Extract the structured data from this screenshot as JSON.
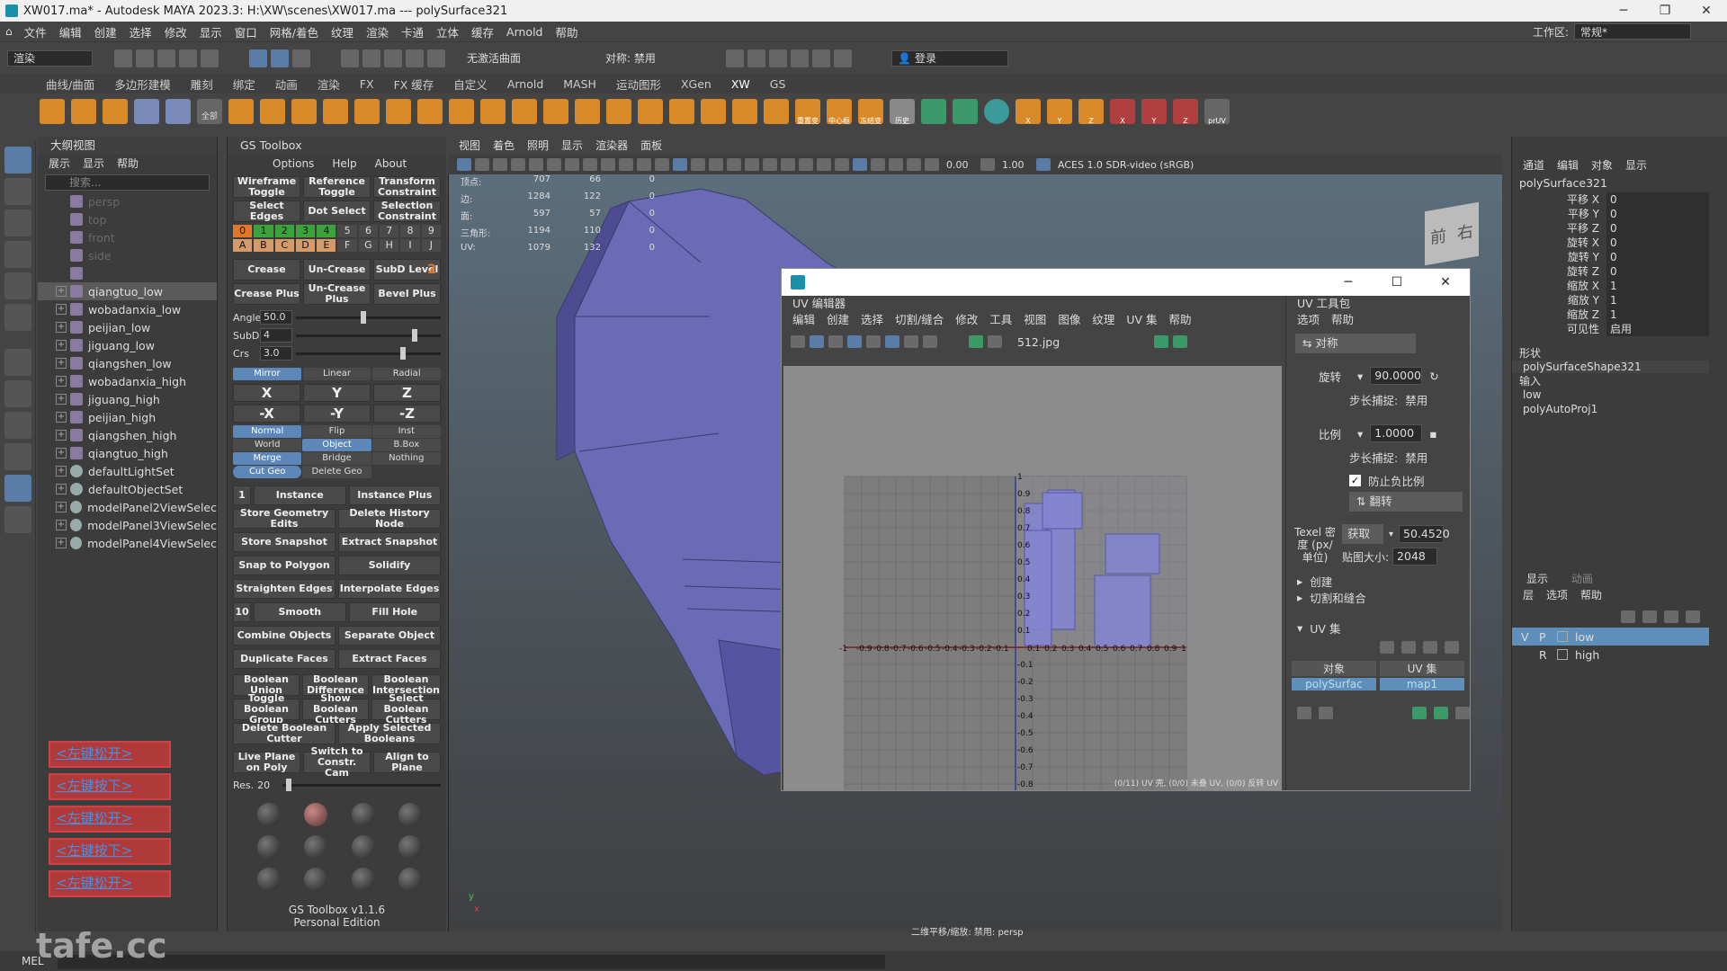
{
  "titlebar": {
    "title": "XW017.ma* - Autodesk MAYA 2023.3: H:\\XW\\scenes\\XW017.ma  ---  polySurface321"
  },
  "menubar": {
    "items": [
      "文件",
      "编辑",
      "创建",
      "选择",
      "修改",
      "显示",
      "窗口",
      "网格/着色",
      "纹理",
      "渲染",
      "卡通",
      "立体",
      "缓存",
      "Arnold",
      "帮助"
    ],
    "workspace_label": "工作区:",
    "workspace_value": "常规*"
  },
  "statusline": {
    "mode": "渲染",
    "live_surface": "无激活曲面",
    "symmetry": "对称: 禁用",
    "login": "登录"
  },
  "shelf": {
    "tabs": [
      "曲线/曲面",
      "多边形建模",
      "雕刻",
      "绑定",
      "动画",
      "渲染",
      "FX",
      "FX 缓存",
      "自定义",
      "Arnold",
      "MASH",
      "运动图形",
      "XGen",
      "XW",
      "GS"
    ],
    "active_tab": "XW",
    "labels": [
      "全部",
      "重置变",
      "中心枢",
      "冻结变",
      "历史",
      "X",
      "Y",
      "Z",
      "X",
      "Y",
      "Z",
      "prUV"
    ]
  },
  "outliner": {
    "title": "大纲视图",
    "menu": [
      "展示",
      "显示",
      "帮助"
    ],
    "search_placeholder": "搜索...",
    "items": [
      {
        "label": "persp",
        "dim": true
      },
      {
        "label": "top",
        "dim": true
      },
      {
        "label": "front",
        "dim": true
      },
      {
        "label": "side",
        "dim": true
      },
      {
        "label": "",
        "dim": true
      },
      {
        "label": "qiangtuo_low",
        "sel": true
      },
      {
        "label": "wobadanxia_low"
      },
      {
        "label": "peijian_low"
      },
      {
        "label": "jiguang_low"
      },
      {
        "label": "qiangshen_low"
      },
      {
        "label": "wobadanxia_high"
      },
      {
        "label": "jiguang_high"
      },
      {
        "label": "peijian_high"
      },
      {
        "label": "qiangshen_high"
      },
      {
        "label": "qiangtuo_high"
      },
      {
        "label": "defaultLightSet"
      },
      {
        "label": "defaultObjectSet"
      },
      {
        "label": "modelPanel2ViewSelec"
      },
      {
        "label": "modelPanel3ViewSelec"
      },
      {
        "label": "modelPanel4ViewSelec"
      }
    ],
    "red_buttons": [
      "<左键松开>",
      "<左键按下>",
      "<左键松开>",
      "<左键按下>",
      "<左键松开>"
    ]
  },
  "gstoolbox": {
    "title": "GS Toolbox",
    "menu": [
      "Options",
      "Help",
      "About"
    ],
    "row1": [
      "Wireframe Toggle",
      "Reference Toggle",
      "Transform Constraint"
    ],
    "row2": [
      "Select Edges",
      "Dot Select",
      "Selection Constraint"
    ],
    "nums": [
      "0",
      "1",
      "2",
      "3",
      "4",
      "5",
      "6",
      "7",
      "8",
      "9"
    ],
    "letters": [
      "A",
      "B",
      "C",
      "D",
      "E",
      "F",
      "G",
      "H",
      "I",
      "J"
    ],
    "row3": [
      "Crease",
      "Un-Crease",
      "SubD Level",
      "2"
    ],
    "row4": [
      "Crease Plus",
      "Un-Crease Plus",
      "Bevel Plus"
    ],
    "angle_label": "Angle",
    "angle_val": "50.0",
    "subd_label": "SubD",
    "subd_val": "4",
    "crs_label": "Crs",
    "crs_val": "3.0",
    "sym_modes": [
      "Mirror",
      "Linear",
      "Radial"
    ],
    "axes": [
      "X",
      "Y",
      "Z",
      "-X",
      "-Y",
      "-Z"
    ],
    "opts1": [
      "Normal",
      "Flip",
      "Inst"
    ],
    "opts2": [
      "World",
      "Object",
      "B.Box"
    ],
    "opts3": [
      "Merge",
      "Bridge",
      "Nothing"
    ],
    "opts4": [
      "Cut Geo",
      "Delete Geo"
    ],
    "instance_count": "1",
    "buttons": [
      [
        "Instance",
        "Instance Plus"
      ],
      [
        "Store Geometry Edits",
        "Delete History Node"
      ],
      [
        "Store Snapshot",
        "Extract Snapshot"
      ],
      [
        "Snap to Polygon",
        "Solidify"
      ],
      [
        "Straighten Edges",
        "Interpolate Edges"
      ],
      [
        "Smooth",
        "Fill Hole"
      ],
      [
        "Combine Objects",
        "Separate Object"
      ],
      [
        "Duplicate Faces",
        "Extract Faces"
      ]
    ],
    "smooth_count": "10",
    "bool_row1": [
      "Boolean Union",
      "Boolean Difference",
      "Boolean Intersection"
    ],
    "bool_row2": [
      "Toggle Boolean Group",
      "Show Boolean Cutters",
      "Select Boolean Cutters"
    ],
    "bool_row3": [
      "Delete Boolean Cutter",
      "Apply Selected Booleans"
    ],
    "plane_row": [
      "Live Plane on Poly",
      "Switch to Constr. Cam",
      "Align to Plane"
    ],
    "res_label": "Res.",
    "res_val": "20",
    "footer1": "GS Toolbox v1.1.6",
    "footer2": "Personal Edition"
  },
  "viewport": {
    "menu": [
      "视图",
      "着色",
      "照明",
      "显示",
      "渲染器",
      "面板"
    ],
    "exposure": "0.00",
    "gamma": "1.00",
    "colorspace": "ACES 1.0 SDR-video (sRGB)",
    "hud_rows": [
      {
        "label": "顶点:",
        "a": "707",
        "b": "66",
        "c": "0"
      },
      {
        "label": "边:",
        "a": "1284",
        "b": "122",
        "c": "0"
      },
      {
        "label": "面:",
        "a": "597",
        "b": "57",
        "c": "0"
      },
      {
        "label": "三角形:",
        "a": "1194",
        "b": "110",
        "c": "0"
      },
      {
        "label": "UV:",
        "a": "1079",
        "b": "132",
        "c": "0"
      }
    ],
    "viewcube_front": "前",
    "viewcube_right": "右",
    "camera_label": "二维平移/缩放: 禁用: persp"
  },
  "uv_editor": {
    "panel_title": "UV 编辑器",
    "menu": [
      "编辑",
      "创建",
      "选择",
      "切割/缝合",
      "修改",
      "工具",
      "视图",
      "图像",
      "纹理",
      "UV 集",
      "帮助"
    ],
    "texture": "512.jpg",
    "status": "(0/11) UV 壳, (0/0) 未叠 UV, (0/0) 反转 UV",
    "axis_x": [
      "-1",
      "-0.9",
      "-0.8",
      "-0.7",
      "-0.6",
      "-0.5",
      "-0.4",
      "-0.3",
      "-0.2",
      "-0.1",
      "0.1",
      "0.2",
      "0.3",
      "0.4",
      "0.5",
      "0.6",
      "0.7",
      "0.8",
      "0.9",
      "1"
    ],
    "axis_y_pos": [
      "1",
      "0.9",
      "0.8",
      "0.7",
      "0.6",
      "0.5",
      "0.4",
      "0.3",
      "0.2",
      "0.1"
    ],
    "axis_y_neg": [
      "-0.1",
      "-0.2",
      "-0.3",
      "-0.4",
      "-0.5",
      "-0.6",
      "-0.7",
      "-0.8",
      "-0.9"
    ]
  },
  "uv_toolkit": {
    "title": "UV 工具包",
    "menu": [
      "选项",
      "帮助"
    ],
    "symmetry_btn": "对称",
    "rotate_label": "旋转",
    "rotate_val": "90.0000",
    "step_label": "步长捕捉:",
    "step_val": "禁用",
    "scale_label": "比例",
    "scale_val": "1.0000",
    "step2_label": "步长捕捉:",
    "step2_val": "禁用",
    "prevent_neg": "防止负比例",
    "flip_btn": "翻转",
    "texel_label": "Texel 密度 (px/单位)",
    "get_btn": "获取",
    "texel_val": "50.4520",
    "map_size_label": "贴图大小:",
    "map_size_val": "2048",
    "create": "创建",
    "cutsew": "切割和缝合",
    "uvset_title": "UV 集",
    "col_object": "对象",
    "col_uvset": "UV 集",
    "object_val": "polySurfac",
    "uvset_val": "map1"
  },
  "channelbox": {
    "menu": [
      "通道",
      "编辑",
      "对象",
      "显示"
    ],
    "object": "polySurface321",
    "channels": [
      {
        "name": "平移 X",
        "value": "0"
      },
      {
        "name": "平移 Y",
        "value": "0"
      },
      {
        "name": "平移 Z",
        "value": "0"
      },
      {
        "name": "旋转 X",
        "value": "0"
      },
      {
        "name": "旋转 Y",
        "value": "0"
      },
      {
        "name": "旋转 Z",
        "value": "0"
      },
      {
        "name": "缩放 X",
        "value": "1"
      },
      {
        "name": "缩放 Y",
        "value": "1"
      },
      {
        "name": "缩放 Z",
        "value": "1"
      },
      {
        "name": "可见性",
        "value": "启用"
      }
    ],
    "shapes_label": "形状",
    "shape": "polySurfaceShape321",
    "inputs_label": "输入",
    "inputs": [
      "low",
      "polyAutoProj1"
    ],
    "layer_tabs": [
      "显示",
      "动画"
    ],
    "layer_menu": [
      "层",
      "选项",
      "帮助"
    ],
    "layers": [
      {
        "v": "V",
        "p": "P",
        "name": "low",
        "sel": true
      },
      {
        "v": "",
        "p": "R",
        "name": "high",
        "sel": false
      }
    ]
  },
  "bottom": {
    "lang": "MEL",
    "watermark": "tafe.cc"
  }
}
